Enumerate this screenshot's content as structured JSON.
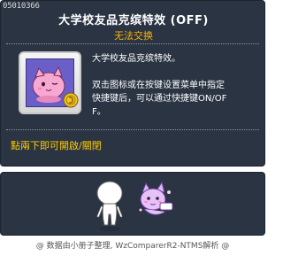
{
  "tooltip": {
    "item_id": "05010366",
    "title": "大学校友品克缤特效 (OFF)",
    "subtitle": "无法交换",
    "description_line1": "大学校友品克缤特效。",
    "description_line2": "双击图标或在按键设置菜单中指定",
    "description_line3": "快捷键后，可以通过快捷键ON/OF",
    "description_line4": "F。",
    "hint": "點兩下即可開啟/關閉"
  },
  "footer": {
    "text": "@ 数据由小册子整理, WzComparerR2-NTMS解析 @"
  },
  "colors": {
    "panel_bg": "#2a3442",
    "title": "#ffffff",
    "subtitle": "#ffb300",
    "hint": "#ffcc00"
  },
  "icons": {
    "item_icon": "pink-bean-icon",
    "coin": "gold-coin-icon",
    "character": "character-avatar",
    "pet": "pink-bean-figure"
  }
}
